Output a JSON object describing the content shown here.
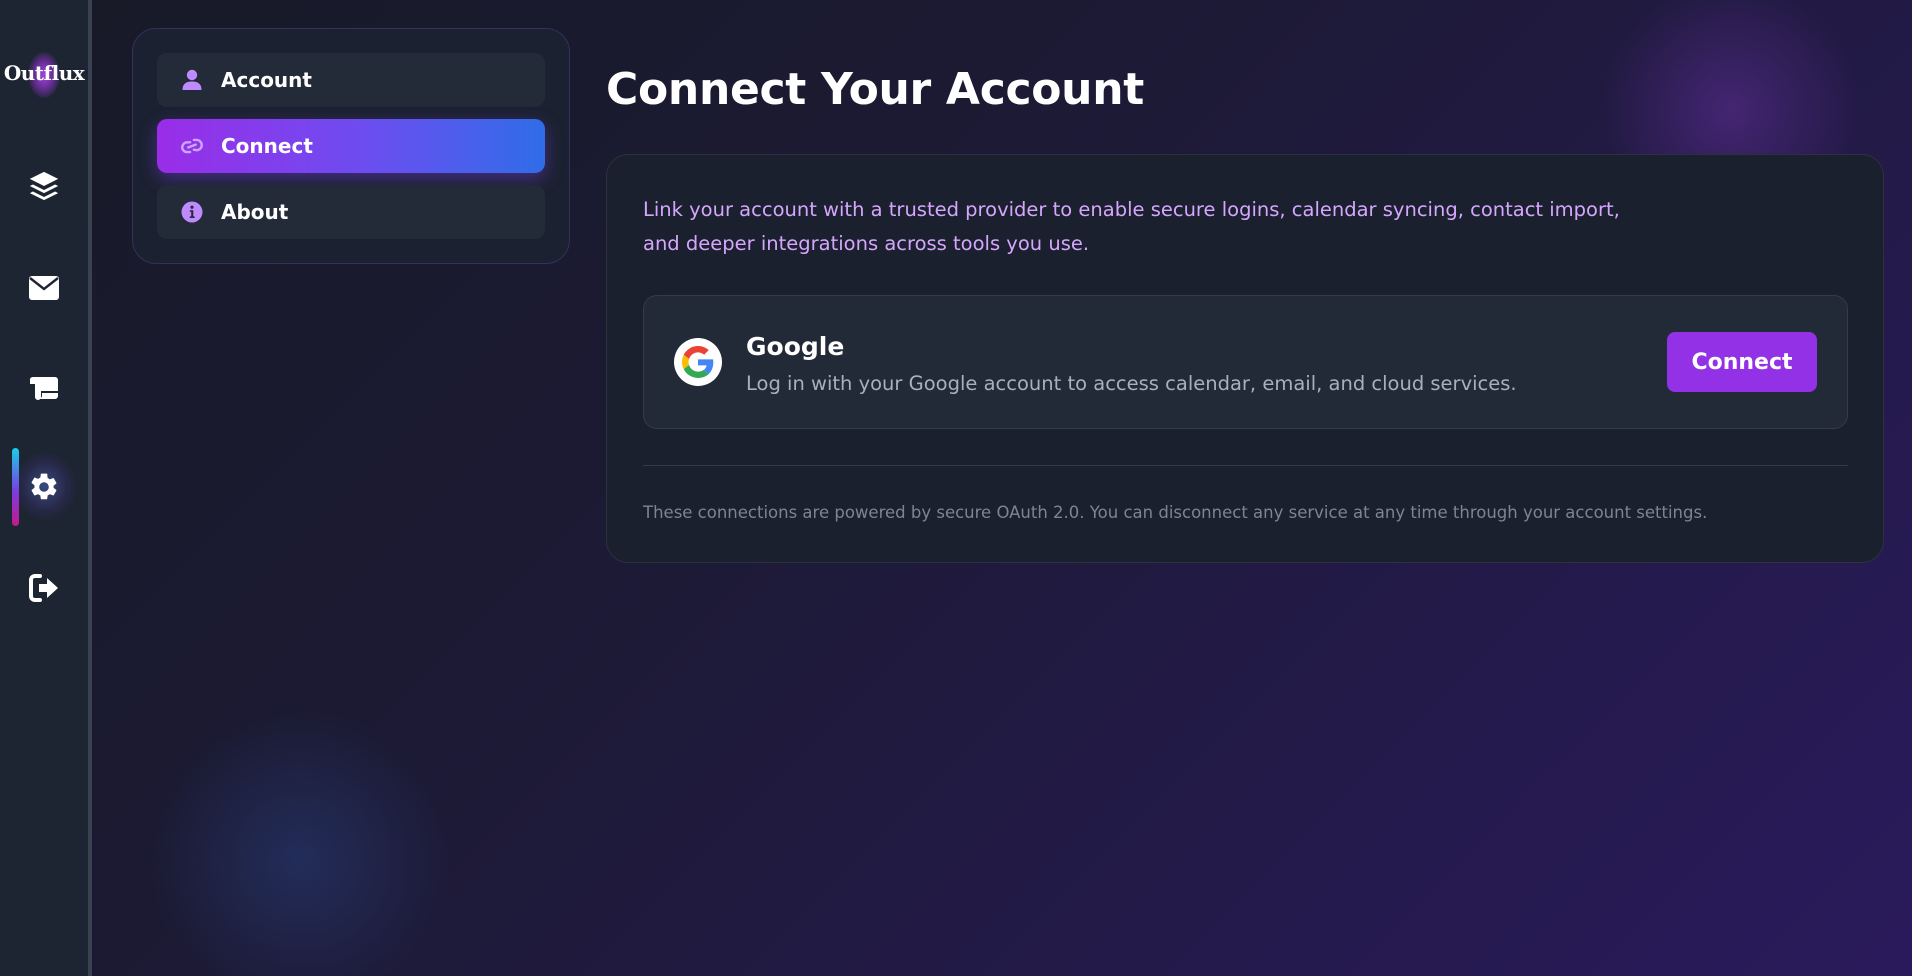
{
  "app": {
    "logo_text": "Outflux"
  },
  "rail": {
    "items": [
      {
        "icon": "layers-icon",
        "active": false
      },
      {
        "icon": "envelope-icon",
        "active": false
      },
      {
        "icon": "scroll-icon",
        "active": false
      },
      {
        "icon": "gear-icon",
        "active": true
      },
      {
        "icon": "sign-out-icon",
        "active": false
      }
    ]
  },
  "settings_nav": {
    "items": [
      {
        "label": "Account",
        "icon": "user-icon",
        "active": false
      },
      {
        "label": "Connect",
        "icon": "link-icon",
        "active": true
      },
      {
        "label": "About",
        "icon": "info-icon",
        "active": false
      }
    ]
  },
  "main": {
    "title": "Connect Your Account",
    "description": "Link your account with a trusted provider to enable secure logins, calendar syncing, contact import, and deeper integrations across tools you use.",
    "providers": [
      {
        "name": "Google",
        "description": "Log in with your Google account to access calendar, email, and cloud services.",
        "icon": "google-icon",
        "button_label": "Connect"
      }
    ],
    "footnote": "These connections are powered by secure OAuth 2.0. You can disconnect any service at any time through your account settings."
  },
  "colors": {
    "accent": "#9331e6",
    "accent_gradient_end": "#2f6de8",
    "description_text": "#d6a6ff",
    "nav_icon": "#c08aff"
  }
}
